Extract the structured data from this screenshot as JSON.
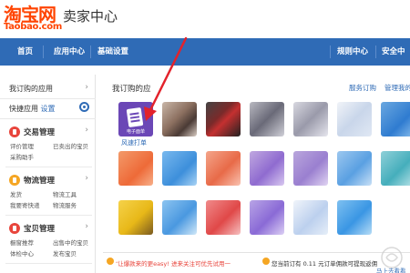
{
  "brand": {
    "logo_cn": "淘宝网",
    "logo_en": "Taobao.com",
    "title": "卖家中心",
    "color": "#ff4400"
  },
  "nav": {
    "bg": "#2f6bb6",
    "items": [
      "首页",
      "应用中心",
      "基础设置",
      "规则中心",
      "安全中"
    ]
  },
  "sidebar": {
    "my_apps": "我订购的应用",
    "quick_apps": "快捷应用",
    "settings_link": "设置",
    "groups": [
      {
        "title": "交易管理",
        "color": "#e8453c",
        "links": [
          "评价管理",
          "已卖出的宝贝",
          "采购助手"
        ]
      },
      {
        "title": "物流管理",
        "color": "#f5a623",
        "links": [
          "发货",
          "物流工具",
          "我要寄快递",
          "物流服务"
        ]
      },
      {
        "title": "宝贝管理",
        "color": "#e8453c",
        "links": [
          "橱窗推荐",
          "出售中的宝贝",
          "体检中心",
          "发布宝贝"
        ]
      }
    ]
  },
  "main": {
    "title": "我订购的应",
    "link_subscribe": "服务订购",
    "link_manage": "管理我的",
    "featured_app": {
      "name": "风速打单",
      "caption": "电子面单",
      "color": "#6b47b6"
    }
  },
  "bottom": {
    "notice1": "‘让爆款来的更easy! 进来关注可优先试用一",
    "notice2": "您当前订有 0.11 元订单佣款可提现返佣",
    "more": "马上去看看"
  }
}
